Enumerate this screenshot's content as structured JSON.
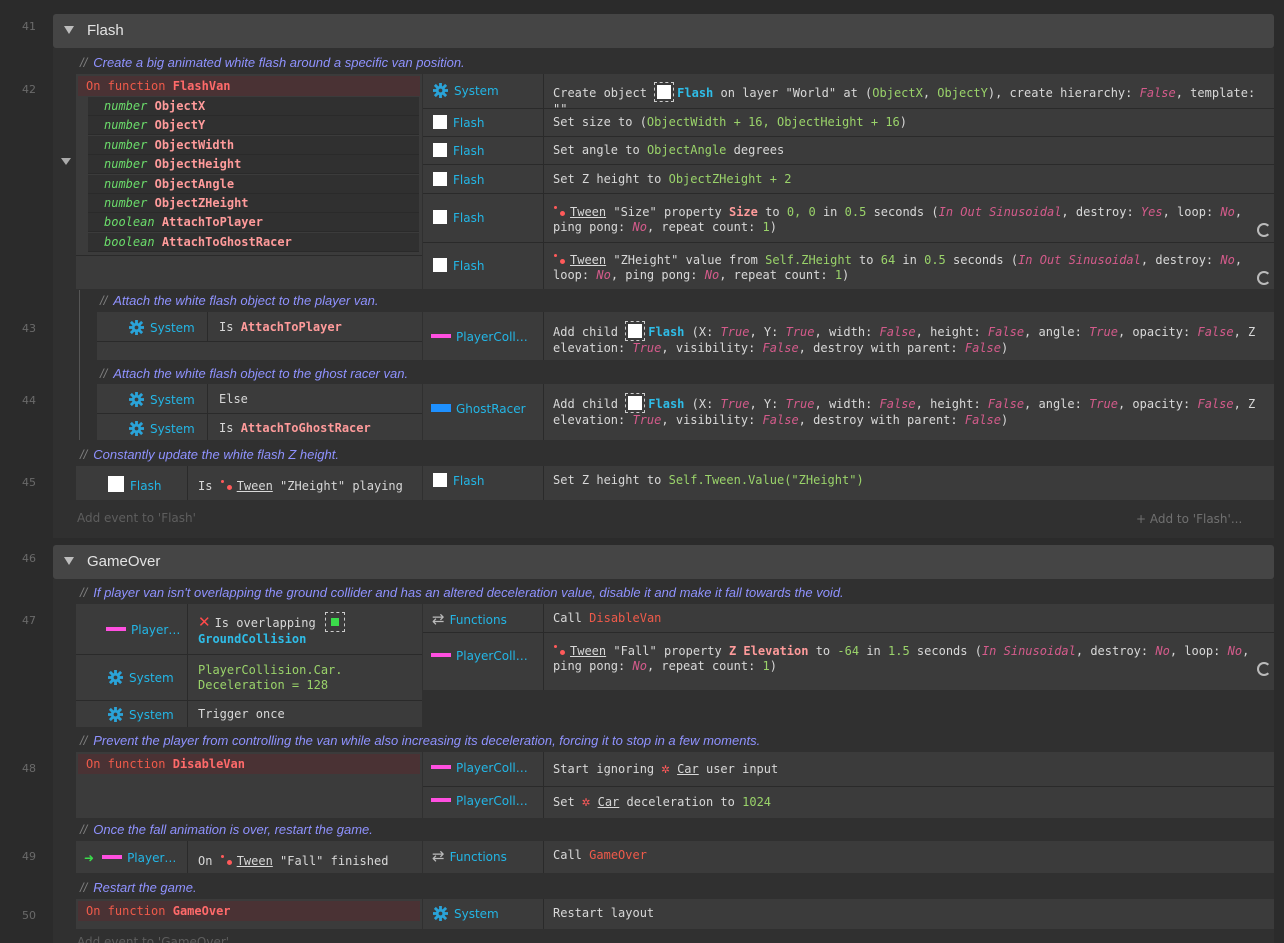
{
  "line_numbers": {
    "l41": "41",
    "l42": "42",
    "l43": "43",
    "l44": "44",
    "l45": "45",
    "l46": "46",
    "l47": "47",
    "l48": "48",
    "l49": "49",
    "l50": "50"
  },
  "groups": {
    "flash": {
      "name": "Flash",
      "add_event": "Add event to 'Flash'",
      "add_to": "+ Add to 'Flash'..."
    },
    "gameover": {
      "name": "GameOver",
      "add_event": "Add event to 'GameOver'"
    }
  },
  "comments": {
    "c1": "Create a big animated white flash around a specific van position.",
    "c2": "Attach the white flash object to the player van.",
    "c3": "Attach the white flash object to the ghost racer van.",
    "c4": "Constantly update the white flash Z height.",
    "c5": "If player van isn't overlapping the ground collider and has an altered deceleration value, disable it and make it fall towards the void.",
    "c6": "Prevent the player from controlling the van while also increasing its deceleration, forcing it to stop in a few moments.",
    "c7": "Once the fall animation is over, restart the game.",
    "c8": "Restart the game.",
    "slash": "//"
  },
  "ev42": {
    "fn_prefix": "On function",
    "fn_name": "FlashVan",
    "params": [
      {
        "type": "number",
        "name": "ObjectX"
      },
      {
        "type": "number",
        "name": "ObjectY"
      },
      {
        "type": "number",
        "name": "ObjectWidth"
      },
      {
        "type": "number",
        "name": "ObjectHeight"
      },
      {
        "type": "number",
        "name": "ObjectAngle"
      },
      {
        "type": "number",
        "name": "ObjectZHeight"
      },
      {
        "type": "boolean",
        "name": "AttachToPlayer"
      },
      {
        "type": "boolean",
        "name": "AttachToGhostRacer"
      }
    ],
    "a1": {
      "obj": "System",
      "t1": "Create object",
      "o": "Flash",
      "t2": "on layer",
      "layer": "\"World\"",
      "t3": "at (",
      "x": "ObjectX",
      "t4": ", ",
      "y": "ObjectY",
      "t5": "), create hierarchy:",
      "h": "False",
      "t6": ", template:",
      "tpl": "\"\""
    },
    "a2": {
      "obj": "Flash",
      "t1": "Set size to (",
      "v": "ObjectWidth + 16, ObjectHeight + 16",
      "t2": ")"
    },
    "a3": {
      "obj": "Flash",
      "t1": "Set angle to",
      "v": "ObjectAngle",
      "t2": "degrees"
    },
    "a4": {
      "obj": "Flash",
      "t1": "Set Z height to",
      "v": "ObjectZHeight + 2"
    },
    "a5": {
      "obj": "Flash",
      "tw": "Tween",
      "name": "\"Size\"",
      "t1": "property",
      "prop": "Size",
      "t2": "to",
      "v": "0, 0",
      "t3": "in",
      "d": "0.5",
      "t4": "seconds (",
      "e": "In Out Sinusoidal",
      "t5": ", destroy:",
      "des": "Yes",
      "t6": ", loop:",
      "lp": "No",
      "t7": ", ping pong:",
      "pp": "No",
      "t8": ", repeat count:",
      "rc": "1",
      "t9": ")"
    },
    "a6": {
      "obj": "Flash",
      "tw": "Tween",
      "name": "\"ZHeight\"",
      "t1": "value from",
      "from": "Self.ZHeight",
      "t2": "to",
      "to": "64",
      "t3": "in",
      "d": "0.5",
      "t4": "seconds (",
      "e": "In Out Sinusoidal",
      "t5": ", destroy:",
      "des": "No",
      "t6": ", loop:",
      "lp": "No",
      "t7": ", ping pong:",
      "pp": "No",
      "t8": ", repeat count:",
      "rc": "1",
      "t9": ")"
    }
  },
  "ev43": {
    "cobj": "System",
    "ctext": "Is",
    "cvar": "AttachToPlayer",
    "aobj": "PlayerColl…",
    "a": {
      "t1": "Add child",
      "o": "Flash",
      "t2": "(X:",
      "x": "True",
      "t3": ", Y:",
      "y": "True",
      "t4": ", width:",
      "w": "False",
      "t5": ", height:",
      "h": "False",
      "t6": ", angle:",
      "an": "True",
      "t7": ", opacity:",
      "op": "False",
      "t8": ", Z elevation:",
      "z": "True",
      "t9": ", visibility:",
      "vis": "False",
      "t10": ", destroy with parent:",
      "dw": "False",
      "t11": ")"
    }
  },
  "ev44": {
    "c1obj": "System",
    "c1text": "Else",
    "c2obj": "System",
    "c2text": "Is",
    "c2var": "AttachToGhostRacer",
    "aobj": "GhostRacer",
    "a": {
      "t1": "Add child",
      "o": "Flash",
      "t2": "(X:",
      "x": "True",
      "t3": ", Y:",
      "y": "True",
      "t4": ", width:",
      "w": "False",
      "t5": ", height:",
      "h": "False",
      "t6": ", angle:",
      "an": "True",
      "t7": ", opacity:",
      "op": "False",
      "t8": ", Z elevation:",
      "z": "True",
      "t9": ", visibility:",
      "vis": "False",
      "t10": ", destroy with parent:",
      "dw": "False",
      "t11": ")"
    }
  },
  "ev45": {
    "cobj": "Flash",
    "ctext": "Is",
    "ctw": "Tween",
    "cname": "\"ZHeight\"",
    "cend": "playing",
    "aobj": "Flash",
    "a": {
      "t1": "Set Z height to",
      "v": "Self.Tween.Value(\"ZHeight\")"
    }
  },
  "ev47": {
    "c1obj": "Player…",
    "c1text": "Is overlapping",
    "c1target": "GroundCollision",
    "c2obj": "System",
    "c2expr": "PlayerCollision.Car.\nDeceleration = 128",
    "c3obj": "System",
    "c3text": "Trigger once",
    "a1obj": "Functions",
    "a1": {
      "t1": "Call",
      "fn": "DisableVan"
    },
    "a2obj": "PlayerColl…",
    "a2": {
      "tw": "Tween",
      "name": "\"Fall\"",
      "t1": "property",
      "prop": "Z Elevation",
      "t2": "to",
      "v": "-64",
      "t3": "in",
      "d": "1.5",
      "t4": "seconds (",
      "e": "In Sinusoidal",
      "t5": ", destroy:",
      "des": "No",
      "t6": ", loop:",
      "lp": "No",
      "t7": ", ping pong:",
      "pp": "No",
      "t8": ", repeat count:",
      "rc": "1",
      "t9": ")"
    }
  },
  "ev48": {
    "fn_prefix": "On function",
    "fn_name": "DisableVan",
    "a1obj": "PlayerColl…",
    "a1": {
      "t1": "Start ignoring",
      "beh": "Car",
      "t2": "user input"
    },
    "a2obj": "PlayerColl…",
    "a2": {
      "t1": "Set",
      "beh": "Car",
      "t2": "deceleration to",
      "v": "1024"
    }
  },
  "ev49": {
    "cobj": "Player…",
    "ctext": "On",
    "ctw": "Tween",
    "cname": "\"Fall\"",
    "cend": "finished",
    "aobj": "Functions",
    "a": {
      "t1": "Call",
      "fn": "GameOver"
    }
  },
  "ev50": {
    "fn_prefix": "On function",
    "fn_name": "GameOver",
    "aobj": "System",
    "a": {
      "t1": "Restart layout"
    }
  }
}
